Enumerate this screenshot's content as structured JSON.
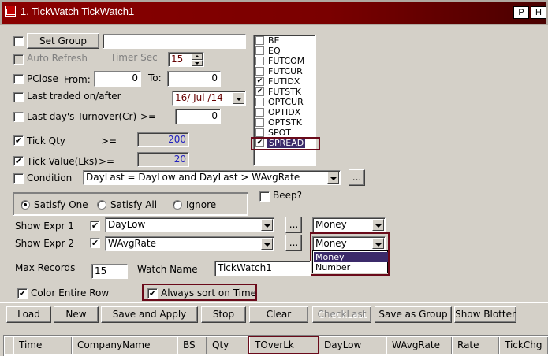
{
  "window": {
    "title": "1. TickWatch TickWatch1",
    "buttons": [
      "P",
      "H"
    ]
  },
  "set_group": {
    "button_label": "Set Group",
    "value": ""
  },
  "auto_refresh": {
    "label": "Auto Refresh",
    "timer_label": "Timer Sec",
    "timer_value": "15"
  },
  "pclose": {
    "label": "PClose",
    "from_label": "From:",
    "from_value": "0",
    "to_label": "To:",
    "to_value": "0"
  },
  "last_traded": {
    "label": "Last traded on/after",
    "date_value": "16/ Jul /14"
  },
  "turnover": {
    "label": "Last day's Turnover(Cr)",
    "op": ">=",
    "value": "0"
  },
  "tick_qty": {
    "label": "Tick Qty",
    "op": ">=",
    "value": "200"
  },
  "tick_value": {
    "label": "Tick Value(Lks)",
    "op": ">=",
    "value": "20"
  },
  "condition": {
    "label": "Condition",
    "value": "DayLast =  DayLow and  DayLast >  WAvgRate",
    "more": "..."
  },
  "series_list": {
    "items": [
      {
        "label": "BE",
        "checked": false
      },
      {
        "label": "EQ",
        "checked": false
      },
      {
        "label": "FUTCOM",
        "checked": false
      },
      {
        "label": "FUTCUR",
        "checked": false
      },
      {
        "label": "FUTIDX",
        "checked": true
      },
      {
        "label": "FUTSTK",
        "checked": true
      },
      {
        "label": "OPTCUR",
        "checked": false
      },
      {
        "label": "OPTIDX",
        "checked": false
      },
      {
        "label": "OPTSTK",
        "checked": false
      },
      {
        "label": "SPOT",
        "checked": false
      },
      {
        "label": "SPREAD",
        "checked": true
      }
    ]
  },
  "beep": {
    "label": "Beep?"
  },
  "satisfy": {
    "one": "Satisfy One",
    "all": "Satisfy All",
    "ignore": "Ignore"
  },
  "expr1": {
    "label": "Show Expr 1",
    "value": "DayLow",
    "more": "...",
    "format": "Money"
  },
  "expr2": {
    "label": "Show Expr 2",
    "value": "WAvgRate",
    "more": "...",
    "format": "Money"
  },
  "format_dropdown": {
    "options": [
      "Money",
      "Number"
    ]
  },
  "max_records": {
    "label": "Max Records",
    "value": "15"
  },
  "watch_name": {
    "label": "Watch Name",
    "value": "TickWatch1"
  },
  "color_row": {
    "label": "Color Entire Row"
  },
  "always_sort": {
    "label": "Always sort on Time"
  },
  "toolbar": {
    "load": "Load",
    "new": "New",
    "save_apply": "Save and Apply",
    "stop": "Stop",
    "clear": "Clear",
    "check_last": "CheckLast",
    "save_group": "Save as Group",
    "show_blotter": "Show Blotter"
  },
  "grid": {
    "columns": [
      "Time",
      "CompanyName",
      "BS",
      "Qty",
      "TOverLk",
      "DayLow",
      "WAvgRate",
      "Rate",
      "TickChg"
    ]
  },
  "colors": {
    "title_bar": "#7a0000",
    "highlight_border": "#6a0a1a",
    "selection": "#3b2a6a"
  }
}
